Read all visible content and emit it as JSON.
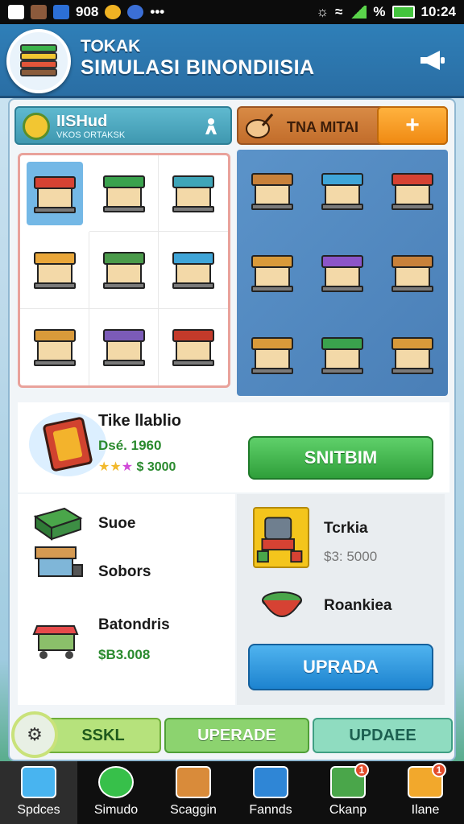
{
  "status_bar": {
    "carrier_text": "908",
    "percent": "%",
    "time": "10:24"
  },
  "header": {
    "title_line1": "TOKAK",
    "title_line2": "SIMULASI BINONDIISIA",
    "icon": "megaphone-icon"
  },
  "tabs": {
    "left": {
      "title": "IISHud",
      "subtitle": "VKOS ORTAKSK",
      "icon": "coin-icon",
      "action_icon": "person-icon"
    },
    "right": {
      "label": "TNA MITAI",
      "icon": "cooking-pot-icon",
      "add_label": "+"
    }
  },
  "shop_grid_left": [
    {
      "name": "red-stall-icon",
      "color": "#d64233"
    },
    {
      "name": "striped-stall-icon",
      "color": "#3aa24d"
    },
    {
      "name": "crate-stall-icon",
      "color": "#3fa5b8"
    },
    {
      "name": "bread-shop-icon",
      "color": "#e8a63a"
    },
    {
      "name": "cart-stall-icon",
      "color": "#4a9a4a"
    },
    {
      "name": "vending-shop-icon",
      "color": "#3fa5d8"
    },
    {
      "name": "cafe-shop-icon",
      "color": "#d99a3a"
    },
    {
      "name": "purple-shop-icon",
      "color": "#7b5bb8"
    },
    {
      "name": "green-box-stall-icon",
      "color": "#c33a2a"
    }
  ],
  "shop_grid_right": [
    {
      "name": "food-stall-icon",
      "color": "#c8813a"
    },
    {
      "name": "blue-roof-shop-icon",
      "color": "#3fa5d8"
    },
    {
      "name": "market-cart-icon",
      "color": "#d64233"
    },
    {
      "name": "kiosk-icon",
      "color": "#d99a3a"
    },
    {
      "name": "fruit-stall-icon",
      "color": "#8c55c8"
    },
    {
      "name": "bakery-stall-icon",
      "color": "#c8813a"
    },
    {
      "name": "noodle-stall-icon",
      "color": "#d99a3a"
    },
    {
      "name": "green-kiosk-icon",
      "color": "#3aa24d"
    },
    {
      "name": "toy-stall-icon",
      "color": "#d99a3a"
    }
  ],
  "featured": {
    "name": "Tike llablio",
    "subtitle": "Dsé. 1960",
    "stars": "★★",
    "star_pink": "★",
    "price": "$ 3000",
    "button": "SNITBIM"
  },
  "list_left": [
    {
      "name": "Suoe",
      "price": "",
      "icon": "counter-stall-icon"
    },
    {
      "name": "Sobors",
      "price": "",
      "icon": "shop-cart-icon"
    },
    {
      "name": "Batondris",
      "price": "$B3.008",
      "icon": "striped-cart-icon"
    }
  ],
  "list_right": {
    "item1": {
      "name": "Tcrkia",
      "price": "$3: 5000",
      "icon": "machine-icon"
    },
    "item2": {
      "name": "Roankiea",
      "icon": "salad-bowl-icon"
    },
    "button": "UPRADA"
  },
  "action_row": {
    "round": "⚙",
    "btn1": "SSKL",
    "btn2": "UPERADE",
    "btn3": "UPDAEE"
  },
  "bottom_nav": [
    {
      "label": "Spdces",
      "icon": "home-icon",
      "badge": ""
    },
    {
      "label": "Simudo",
      "icon": "search-icon",
      "badge": ""
    },
    {
      "label": "Scaggin",
      "icon": "chest-icon",
      "badge": ""
    },
    {
      "label": "Fannds",
      "icon": "phone-icon",
      "badge": ""
    },
    {
      "label": "Ckanp",
      "icon": "map-icon",
      "badge": "1"
    },
    {
      "label": "Ilane",
      "icon": "document-icon",
      "badge": "1"
    }
  ]
}
